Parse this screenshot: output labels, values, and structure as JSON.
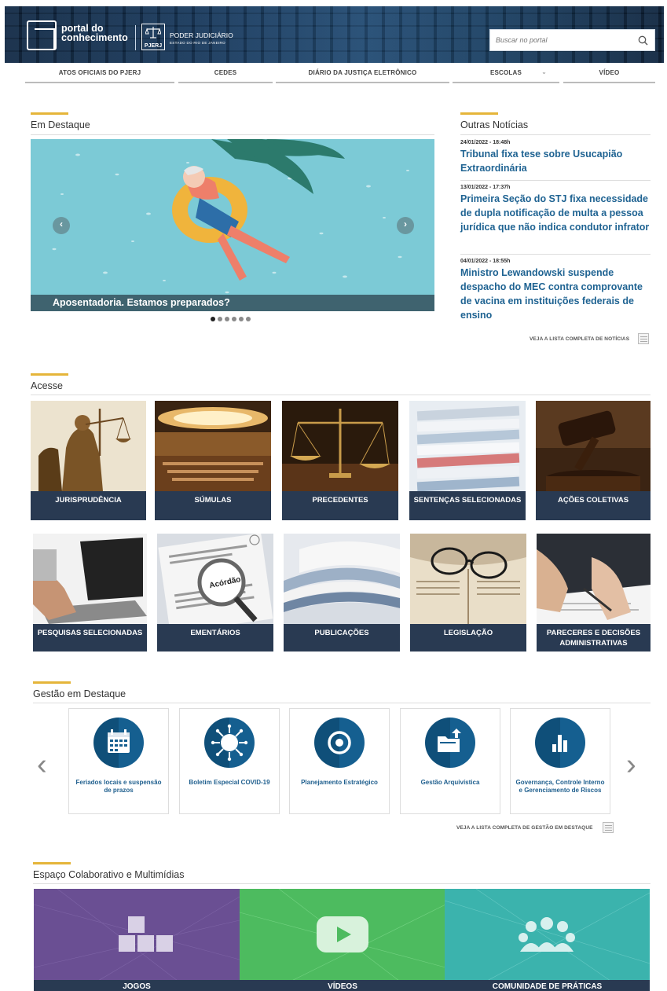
{
  "header": {
    "logo_line1": "portal do",
    "logo_line2": "conhecimento",
    "pj_emblem_text": "PJERJ",
    "pj_title": "PODER JUDICIÁRIO",
    "pj_subtitle": "ESTADO DO RIO DE JANEIRO",
    "search_placeholder": "Buscar no portal"
  },
  "nav": {
    "items": [
      {
        "label": "ATOS OFICIAIS DO PJERJ"
      },
      {
        "label": "CEDES"
      },
      {
        "label": "DIÁRIO DA JUSTIÇA ELETRÔNICO"
      },
      {
        "label": "ESCOLAS"
      },
      {
        "label": "VÍDEO"
      }
    ]
  },
  "destaque": {
    "title": "Em Destaque",
    "caption": "Aposentadoria. Estamos preparados?",
    "slide_count": 6,
    "active_slide": 1,
    "prev_label": "‹",
    "next_label": "›"
  },
  "noticias": {
    "title": "Outras Notícias",
    "items": [
      {
        "date": "24/01/2022 - 18:48h",
        "headline": "Tribunal fixa tese sobre Usucapião Extraordinária"
      },
      {
        "date": "13/01/2022 - 17:37h",
        "headline": "Primeira Seção do STJ fixa necessidade de dupla notificação de multa a pessoa jurídica que não indica condutor infrator"
      },
      {
        "date": "04/01/2022 - 18:55h",
        "headline": "Ministro Lewandowski suspende despacho do MEC contra comprovante de vacina em instituições federais de ensino"
      }
    ],
    "more_label": "VEJA A LISTA COMPLETA DE NOTÍCIAS"
  },
  "acesse": {
    "title": "Acesse",
    "tiles": [
      {
        "label": "JURISPRUDÊNCIA"
      },
      {
        "label": "SÚMULAS"
      },
      {
        "label": "PRECEDENTES"
      },
      {
        "label": "SENTENÇAS SELECIONADAS"
      },
      {
        "label": "AÇÕES COLETIVAS"
      },
      {
        "label": "PESQUISAS SELECIONADAS"
      },
      {
        "label": "EMENTÁRIOS"
      },
      {
        "label": "PUBLICAÇÕES"
      },
      {
        "label": "LEGISLAÇÃO"
      },
      {
        "label": "PARECERES E DECISÕES ADMINISTRATIVAS"
      }
    ],
    "magnifier_word": "Acórdão"
  },
  "gestao": {
    "title": "Gestão em Destaque",
    "cards": [
      {
        "label": "Feriados locais e suspensão de prazos",
        "icon": "calendar-icon"
      },
      {
        "label": "Boletim Especial COVID-19",
        "icon": "virus-icon"
      },
      {
        "label": "Planejamento Estratégico",
        "icon": "target-icon"
      },
      {
        "label": "Gestão Arquivística",
        "icon": "folder-upload-icon"
      },
      {
        "label": "Governança, Controle Interno e Gerenciamento de Riscos",
        "icon": "bar-chart-icon"
      }
    ],
    "prev_label": "‹",
    "next_label": "›",
    "more_label": "VEJA A LISTA COMPLETA DE GESTÃO EM DESTAQUE"
  },
  "colaborativo": {
    "title": "Espaço Colaborativo e Multimídias",
    "items": [
      {
        "label": "JOGOS"
      },
      {
        "label": "VÍDEOS"
      },
      {
        "label": "COMUNIDADE DE PRÁTICAS"
      }
    ]
  },
  "colors": {
    "accent": "#e5b53a",
    "link_blue": "#1f6392",
    "tile_label_bg": "#293a52",
    "circle_blue": "#155f90"
  }
}
